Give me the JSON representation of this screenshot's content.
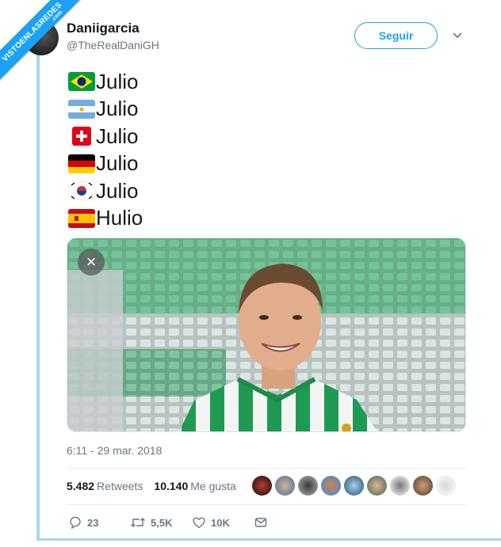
{
  "watermark": {
    "text": "VISTOENLASREDES",
    "sub": ".com"
  },
  "author": {
    "name": "Daniigarcia",
    "handle": "@TheRealDaniGH"
  },
  "follow_label": "Seguir",
  "tweet_lines": [
    {
      "flag": "brazil-flag",
      "text": "Julio"
    },
    {
      "flag": "argentina-flag",
      "text": "Julio"
    },
    {
      "flag": "switzerland-flag",
      "text": "Julio"
    },
    {
      "flag": "germany-flag",
      "text": "Julio"
    },
    {
      "flag": "south-korea-flag",
      "text": "Julio"
    },
    {
      "flag": "spain-flag",
      "text": "Hulio"
    }
  ],
  "media": {
    "close_icon": "×"
  },
  "timestamp": "6:11 - 29 mar. 2018",
  "stats": {
    "retweets_count": "5.482",
    "retweets_label": "Retweets",
    "likes_count": "10.140",
    "likes_label": "Me gusta"
  },
  "actions": {
    "replies": "23",
    "retweets": "5,5K",
    "likes": "10K"
  },
  "colors": {
    "accent": "#1da1f2",
    "muted": "#657786",
    "text": "#14171a"
  }
}
